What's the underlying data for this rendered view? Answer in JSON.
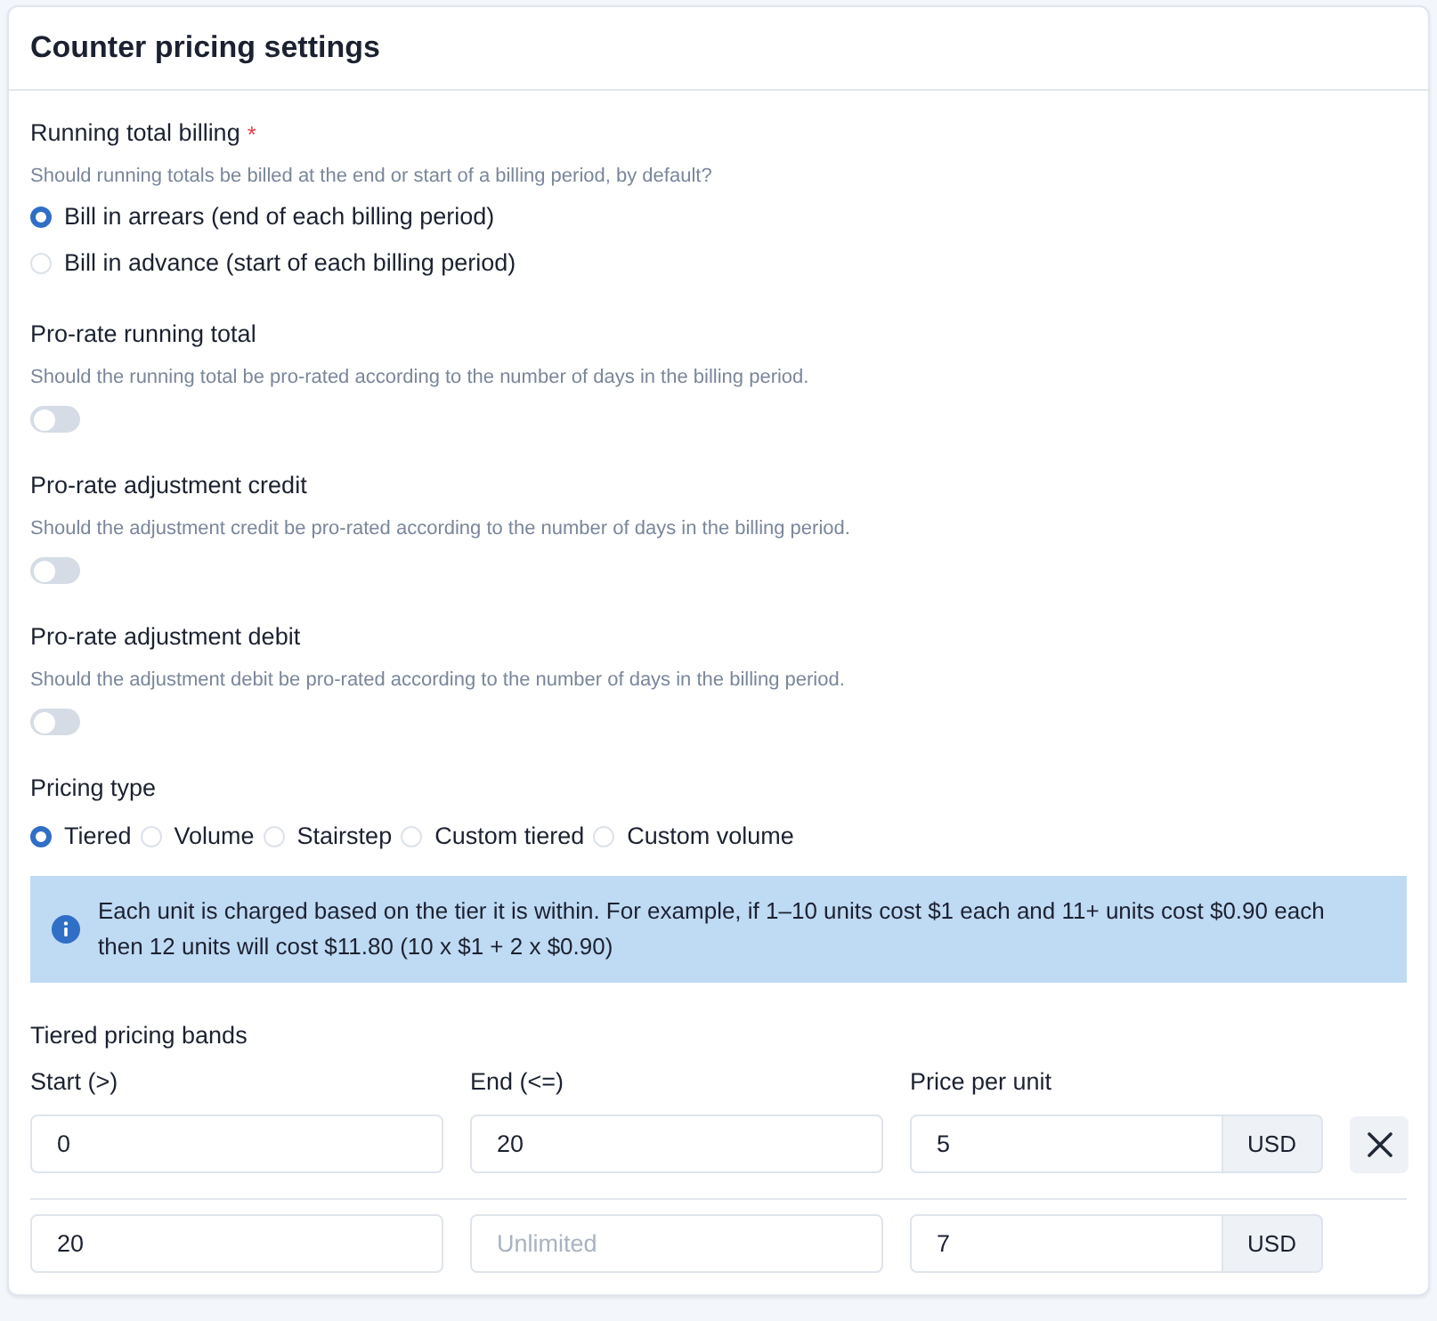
{
  "title": "Counter pricing settings",
  "billing": {
    "label": "Running total billing",
    "required_mark": "*",
    "hint": "Should running totals be billed at the end or start of a billing period, by default?",
    "options": [
      {
        "label": "Bill in arrears (end of each billing period)",
        "selected": true
      },
      {
        "label": "Bill in advance (start of each billing period)",
        "selected": false
      }
    ]
  },
  "toggles": [
    {
      "label": "Pro-rate running total",
      "hint": "Should the running total be pro-rated according to the number of days in the billing period.",
      "on": false
    },
    {
      "label": "Pro-rate adjustment credit",
      "hint": "Should the adjustment credit be pro-rated according to the number of days in the billing period.",
      "on": false
    },
    {
      "label": "Pro-rate adjustment debit",
      "hint": "Should the adjustment debit be pro-rated according to the number of days in the billing period.",
      "on": false
    }
  ],
  "pricing_type": {
    "label": "Pricing type",
    "options": [
      {
        "label": "Tiered",
        "selected": true
      },
      {
        "label": "Volume",
        "selected": false
      },
      {
        "label": "Stairstep",
        "selected": false
      },
      {
        "label": "Custom tiered",
        "selected": false
      },
      {
        "label": "Custom volume",
        "selected": false
      }
    ]
  },
  "info": "Each unit is charged based on the tier it is within. For example, if 1–10 units cost $1 each and 11+ units cost $0.90 each then 12 units will cost $11.80 (10 x $1 + 2 x $0.90)",
  "bands": {
    "title": "Tiered pricing bands",
    "columns": [
      "Start (>)",
      "End (<=)",
      "Price per unit"
    ],
    "rows": [
      {
        "start": "0",
        "end": "20",
        "price": "5",
        "currency": "USD",
        "removable": true
      },
      {
        "start": "20",
        "end_placeholder": "Unlimited",
        "price": "7",
        "currency": "USD",
        "removable": false
      }
    ]
  }
}
